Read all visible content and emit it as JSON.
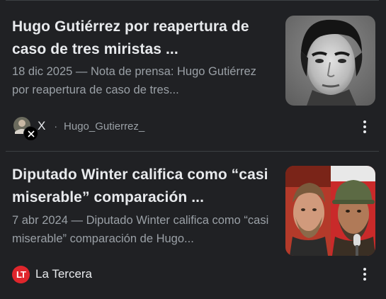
{
  "results": [
    {
      "title": "Hugo Gutiérrez por reapertura de caso de tres miristas ...",
      "snippet": "18 dic 2025 — Nota de prensa: Hugo Gutiérrez por reapertura de caso de tres...",
      "source_name": "X",
      "separator": "·",
      "source_handle": "Hugo_Gutierrez_",
      "thumbnail": "black-and-white-portrait",
      "favicon": "x-avatar-icon"
    },
    {
      "title": "Diputado Winter califica como “casi miserable” comparación ...",
      "snippet": "7 abr 2024 — Diputado Winter califica como “casi miserable” comparación de Hugo...",
      "source_name": "La Tercera",
      "source_logo_text": "LT",
      "thumbnail": "two-portraits-split",
      "favicon": "la-tercera-logo-icon"
    }
  ],
  "colors": {
    "background": "#202124",
    "title": "#e8eaed",
    "snippet": "#9aa0a6",
    "divider": "#3c4043",
    "la_tercera_red": "#e0262c"
  }
}
